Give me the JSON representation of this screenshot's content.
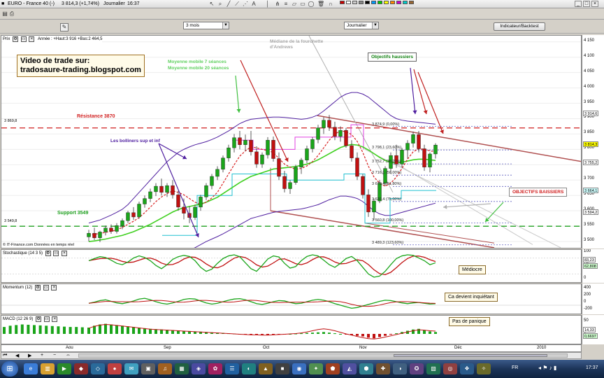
{
  "window": {
    "title": "EURO - France 40 (-)",
    "quote": "3 814,3 (+1,74%)",
    "view": "Journalier",
    "time": "16:37"
  },
  "toolbar": {
    "period_select": "3 mois",
    "interval_select": "Journalier",
    "indicator_button": "Indicateur/Backtest"
  },
  "price_panel": {
    "label": "Prix",
    "header_info": "Année : +Haut:3 916 +Bas:2 464,5",
    "source": "© IT-Finance.com  Données en temps réel",
    "y_ticks": [
      "4 150",
      "4 100",
      "4 050",
      "4 000",
      "3 950",
      "3 900",
      "3 850",
      "3 800",
      "3 750",
      "3 700",
      "3 650",
      "3 600",
      "3 550",
      "3 500"
    ],
    "price_tags": [
      {
        "text": "3 914,6",
        "color": "#000000",
        "bg": "#ffffff",
        "v": 3914.6
      },
      {
        "text": "3 814,3",
        "color": "#000000",
        "bg": "#ffff00",
        "v": 3814.3
      },
      {
        "text": "3 755,2",
        "color": "#000000",
        "bg": "#ffffff",
        "v": 3755.2
      },
      {
        "text": "3 664,1",
        "color": "#000000",
        "bg": "#cfffff",
        "v": 3664.1
      },
      {
        "text": "3 594,2",
        "color": "#000000",
        "bg": "#ffffff",
        "v": 3594.2
      }
    ],
    "resistance": {
      "label": "Résistance 3870",
      "value_label": "3 869,8",
      "v": 3869.8
    },
    "support": {
      "label": "Support 3549",
      "value_label": "3 549,8",
      "v": 3549.8
    },
    "fib_levels": [
      {
        "text": "3 874,9 (0,00%)",
        "v": 3874.9
      },
      {
        "text": "3 798,1 (23,60%)",
        "v": 3798.1
      },
      {
        "text": "3 752,7 (38,20%)",
        "v": 3752.7
      },
      {
        "text": "3 716,1 (50,00%)",
        "v": 3716.1
      },
      {
        "text": "3 679,4 (61,80%)",
        "v": 3679.4
      },
      {
        "text": "3 630,4 (75,00%)",
        "v": 3630.4
      },
      {
        "text": "3 560,8 (100,00%)",
        "v": 3560.8
      },
      {
        "text": "3 489,3 (123,60%)",
        "v": 3489.3
      }
    ],
    "annotations": {
      "video_line1": "Video de trade sur:",
      "video_line2": "tradosaure-trading.blogspot.com",
      "ma_line1": "Moyenne mobile 7 séances",
      "ma_line2": "Moyenne mobile 20 séances",
      "mediane_line1": "Médiane de la fourchette",
      "mediane_line2": "d'Andrews",
      "objectifs_haussiers": "Objectifs haussiers",
      "bollinger": "Les bolliners sup et inf",
      "objectifs_baissiers": "OBJECTIFS BAISSIERS"
    }
  },
  "stoch_panel": {
    "label": "Stochastique (14 3 5)",
    "comment": "Médiocre",
    "y_ticks": [
      "100",
      "50",
      "0"
    ],
    "tags": [
      {
        "text": "83,23",
        "bg": "#ffffff"
      },
      {
        "text": "62,808",
        "bg": "#cfffcf"
      }
    ]
  },
  "momentum_panel": {
    "label": "Momentum (12)",
    "comment": "Ca devient inquiétant",
    "y_ticks": [
      "400",
      "200",
      "0",
      "-200"
    ]
  },
  "macd_panel": {
    "label": "MACD (12 26 9)",
    "comment": "Pas de panique",
    "y_ticks": [
      "50",
      "0"
    ],
    "tags": [
      {
        "text": "14,33",
        "bg": "#ffffff"
      },
      {
        "text": "0,6697",
        "bg": "#cfffcf"
      }
    ]
  },
  "x_axis": [
    "Aou",
    "Sep",
    "Oct",
    "Nov",
    "Déc",
    "2010"
  ],
  "taskbar": {
    "lang": "FR",
    "clock": "17:37"
  },
  "colors": {
    "bull": "#1aa51a",
    "bear": "#c01010",
    "ma7": "#d82020",
    "ma20": "#40d020",
    "bollinger": "#5020a0",
    "resist": "#d02020",
    "support": "#20a020"
  },
  "chart_data": {
    "type": "candlestick",
    "y_range": [
      3475,
      4170
    ],
    "ohlc": [
      [
        3515,
        3538,
        3500,
        3527
      ],
      [
        3527,
        3545,
        3505,
        3512
      ],
      [
        3512,
        3535,
        3498,
        3531
      ],
      [
        3531,
        3552,
        3520,
        3544
      ],
      [
        3544,
        3556,
        3525,
        3533
      ],
      [
        3533,
        3560,
        3526,
        3552
      ],
      [
        3552,
        3575,
        3540,
        3568
      ],
      [
        3568,
        3600,
        3560,
        3594
      ],
      [
        3594,
        3612,
        3570,
        3580
      ],
      [
        3580,
        3630,
        3574,
        3622
      ],
      [
        3622,
        3650,
        3610,
        3640
      ],
      [
        3640,
        3672,
        3628,
        3662
      ],
      [
        3662,
        3690,
        3648,
        3680
      ],
      [
        3680,
        3705,
        3650,
        3660
      ],
      [
        3660,
        3690,
        3645,
        3682
      ],
      [
        3682,
        3700,
        3640,
        3652
      ],
      [
        3652,
        3665,
        3600,
        3612
      ],
      [
        3612,
        3640,
        3572,
        3592
      ],
      [
        3592,
        3615,
        3560,
        3578
      ],
      [
        3578,
        3620,
        3570,
        3612
      ],
      [
        3612,
        3652,
        3600,
        3645
      ],
      [
        3645,
        3690,
        3635,
        3682
      ],
      [
        3682,
        3720,
        3670,
        3712
      ],
      [
        3712,
        3745,
        3700,
        3735
      ],
      [
        3735,
        3780,
        3725,
        3772
      ],
      [
        3772,
        3815,
        3760,
        3805
      ],
      [
        3805,
        3850,
        3790,
        3838
      ],
      [
        3838,
        3860,
        3800,
        3815
      ],
      [
        3815,
        3848,
        3795,
        3830
      ],
      [
        3830,
        3860,
        3780,
        3792
      ],
      [
        3792,
        3810,
        3740,
        3752
      ],
      [
        3752,
        3790,
        3740,
        3782
      ],
      [
        3782,
        3840,
        3770,
        3830
      ],
      [
        3830,
        3842,
        3760,
        3770
      ],
      [
        3770,
        3790,
        3700,
        3712
      ],
      [
        3712,
        3730,
        3660,
        3672
      ],
      [
        3672,
        3700,
        3655,
        3692
      ],
      [
        3692,
        3750,
        3685,
        3742
      ],
      [
        3742,
        3772,
        3720,
        3765
      ],
      [
        3765,
        3812,
        3755,
        3802
      ],
      [
        3802,
        3840,
        3790,
        3832
      ],
      [
        3832,
        3880,
        3820,
        3870
      ],
      [
        3870,
        3905,
        3850,
        3895
      ],
      [
        3895,
        3912,
        3860,
        3872
      ],
      [
        3872,
        3890,
        3830,
        3842
      ],
      [
        3842,
        3875,
        3825,
        3862
      ],
      [
        3862,
        3870,
        3805,
        3812
      ],
      [
        3812,
        3830,
        3760,
        3772
      ],
      [
        3772,
        3790,
        3700,
        3712
      ],
      [
        3712,
        3720,
        3640,
        3652
      ],
      [
        3652,
        3670,
        3580,
        3596
      ],
      [
        3596,
        3640,
        3570,
        3632
      ],
      [
        3632,
        3700,
        3625,
        3690
      ],
      [
        3690,
        3745,
        3680,
        3738
      ],
      [
        3738,
        3790,
        3720,
        3780
      ],
      [
        3780,
        3815,
        3740,
        3752
      ],
      [
        3752,
        3805,
        3742,
        3798
      ],
      [
        3798,
        3830,
        3770,
        3820
      ],
      [
        3820,
        3858,
        3806,
        3848
      ],
      [
        3848,
        3860,
        3790,
        3802
      ],
      [
        3802,
        3815,
        3730,
        3742
      ],
      [
        3742,
        3790,
        3725,
        3785
      ],
      [
        3785,
        3820,
        3770,
        3814
      ]
    ],
    "ma7": [
      3520,
      3524,
      3526,
      3530,
      3533,
      3538,
      3546,
      3556,
      3566,
      3578,
      3594,
      3612,
      3630,
      3645,
      3656,
      3665,
      3660,
      3652,
      3640,
      3628,
      3620,
      3628,
      3642,
      3660,
      3690,
      3720,
      3750,
      3778,
      3795,
      3808,
      3805,
      3800,
      3796,
      3790,
      3770,
      3752,
      3742,
      3735,
      3738,
      3746,
      3760,
      3780,
      3805,
      3830,
      3850,
      3860,
      3858,
      3848,
      3826,
      3790,
      3745,
      3710,
      3690,
      3680,
      3690,
      3710,
      3738,
      3768,
      3792,
      3802,
      3800,
      3795,
      3792
    ],
    "ma20": [
      3500,
      3502,
      3505,
      3508,
      3512,
      3516,
      3520,
      3526,
      3532,
      3540,
      3548,
      3556,
      3566,
      3576,
      3586,
      3596,
      3604,
      3610,
      3614,
      3618,
      3622,
      3628,
      3636,
      3644,
      3656,
      3668,
      3680,
      3692,
      3702,
      3712,
      3718,
      3724,
      3730,
      3736,
      3738,
      3740,
      3742,
      3744,
      3748,
      3752,
      3758,
      3766,
      3776,
      3786,
      3796,
      3806,
      3812,
      3816,
      3814,
      3808,
      3798,
      3786,
      3774,
      3764,
      3758,
      3756,
      3758,
      3762,
      3766,
      3768,
      3768,
      3766,
      3764
    ],
    "boll_up": [
      3560,
      3565,
      3570,
      3578,
      3586,
      3595,
      3605,
      3620,
      3640,
      3660,
      3680,
      3700,
      3720,
      3740,
      3760,
      3775,
      3790,
      3800,
      3808,
      3815,
      3820,
      3825,
      3832,
      3840,
      3850,
      3860,
      3872,
      3884,
      3892,
      3898,
      3900,
      3902,
      3904,
      3905,
      3905,
      3904,
      3902,
      3900,
      3898,
      3900,
      3905,
      3912,
      3925,
      3940,
      3955,
      3970,
      3980,
      3985,
      3985,
      3980,
      3970,
      3955,
      3940,
      3925,
      3910,
      3900,
      3895,
      3892,
      3890,
      3888,
      3886,
      3884,
      3882
    ],
    "boll_low": [
      3440,
      3440,
      3441,
      3440,
      3440,
      3438,
      3436,
      3434,
      3430,
      3425,
      3420,
      3420,
      3422,
      3425,
      3430,
      3440,
      3452,
      3462,
      3472,
      3480,
      3490,
      3500,
      3508,
      3516,
      3525,
      3535,
      3545,
      3555,
      3565,
      3575,
      3580,
      3585,
      3590,
      3595,
      3598,
      3600,
      3602,
      3604,
      3606,
      3610,
      3615,
      3620,
      3628,
      3636,
      3642,
      3648,
      3648,
      3645,
      3640,
      3630,
      3615,
      3600,
      3590,
      3585,
      3585,
      3590,
      3595,
      3600,
      3605,
      3610,
      3615,
      3620,
      3625
    ],
    "x_labels": [
      "Aou",
      "Sep",
      "Oct",
      "Nov",
      "Déc",
      "2010"
    ]
  }
}
